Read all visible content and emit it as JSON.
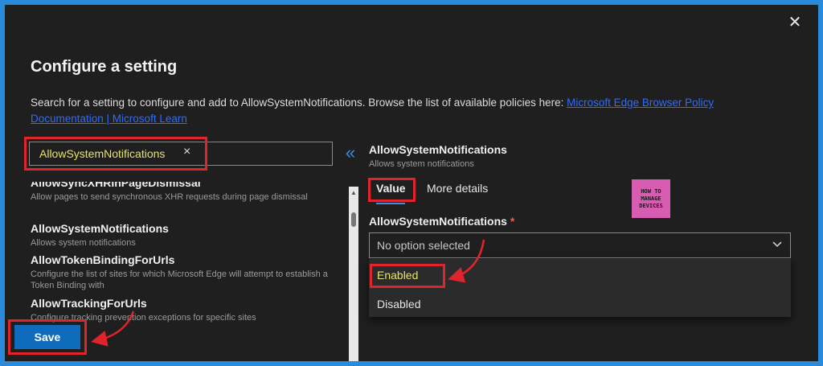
{
  "dialog": {
    "title": "Configure a setting",
    "description": "Search for a setting to configure and add to AllowSystemNotifications. Browse the list of available policies here: ",
    "link_text": "Microsoft Edge Browser Policy Documentation | Microsoft Learn",
    "close_icon": "close-icon"
  },
  "search": {
    "value": "AllowSystemNotifications",
    "clear_icon": "×"
  },
  "collapse_icon": "«",
  "list": {
    "items": [
      {
        "name": "AllowSyncXHRInPageDismissal",
        "desc": "Allow pages to send synchronous XHR requests during page dismissal"
      },
      {
        "name": "AllowSystemNotifications",
        "desc": "Allows system notifications"
      },
      {
        "name": "AllowTokenBindingForUrls",
        "desc": "Configure the list of sites for which Microsoft Edge will attempt to establish a Token Binding with"
      },
      {
        "name": "AllowTrackingForUrls",
        "desc": "Configure tracking prevention exceptions for specific sites"
      }
    ]
  },
  "save_label": "Save",
  "detail": {
    "title": "AllowSystemNotifications",
    "subtitle": "Allows system notifications",
    "tabs": [
      {
        "label": "Value"
      },
      {
        "label": "More details"
      }
    ],
    "field_label": "AllowSystemNotifications",
    "required_mark": "*",
    "dropdown": {
      "value": "No option selected",
      "options": [
        "Enabled",
        "Disabled"
      ]
    }
  },
  "logo": {
    "line1": "HOW TO",
    "line2": "MANAGE",
    "line3": "DEVICES"
  },
  "colors": {
    "frame": "#2a8bdc",
    "background": "#1f1f1f",
    "accent": "#0f6cbd",
    "highlight": "#e0242b",
    "search_text": "#e6e36a",
    "logo": "#d65db1"
  }
}
